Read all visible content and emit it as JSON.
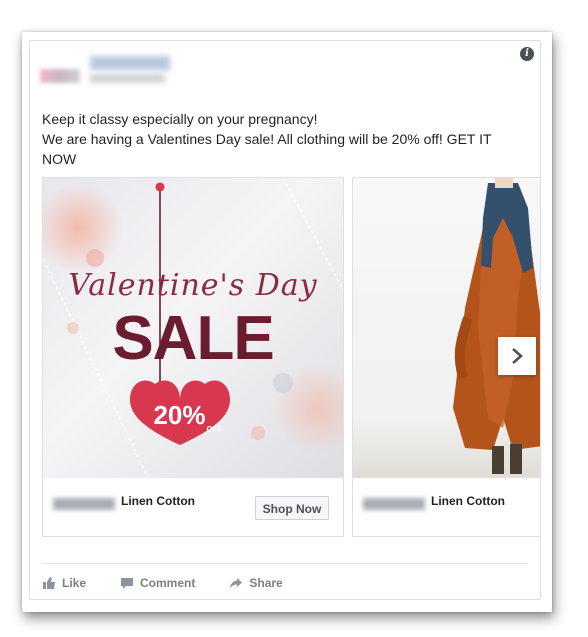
{
  "post": {
    "info_icon": "info-icon",
    "text_lines": [
      "Keep it classy especially on your pregnancy!",
      "We are having a Valentines Day sale! All clothing will be 20% off! GET IT",
      "NOW"
    ]
  },
  "carousel": {
    "cards": [
      {
        "image_text": {
          "headline": "Valentine's Day",
          "sale": "SALE",
          "discount": "20%",
          "off": "OFF"
        },
        "title": "Linen Cotton",
        "cta": "Shop Now"
      },
      {
        "title": "Linen Cotton"
      }
    ],
    "next_icon": "chevron-right-icon"
  },
  "actions": {
    "like": "Like",
    "comment": "Comment",
    "share": "Share"
  },
  "colors": {
    "text": "#1d2129",
    "muted": "#7f7f7f",
    "sale_red": "#6b1d30",
    "heart": "#d7384f"
  }
}
